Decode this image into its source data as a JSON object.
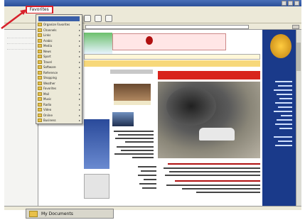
{
  "window": {
    "menu_favorites": "Favorites"
  },
  "favorites_menu": {
    "items": [
      {
        "label": "Organize Favorites"
      },
      {
        "label": "Channels"
      },
      {
        "label": "Links"
      },
      {
        "label": "Arabic"
      },
      {
        "label": "Media"
      },
      {
        "label": "News"
      },
      {
        "label": "Sport"
      },
      {
        "label": "Travel"
      },
      {
        "label": "Software"
      },
      {
        "label": "Reference"
      },
      {
        "label": "Shopping"
      },
      {
        "label": "Weather"
      },
      {
        "label": "Favorites"
      },
      {
        "label": "Mail"
      },
      {
        "label": "Music"
      },
      {
        "label": "Radio"
      },
      {
        "label": "Video"
      },
      {
        "label": "Online"
      },
      {
        "label": "Business"
      }
    ]
  },
  "taskbar": {
    "folder_label": "My Documents"
  },
  "colors": {
    "highlight": "#d8202a",
    "sidebar": "#1a3a8a",
    "headline_bar": "#d8241c"
  }
}
